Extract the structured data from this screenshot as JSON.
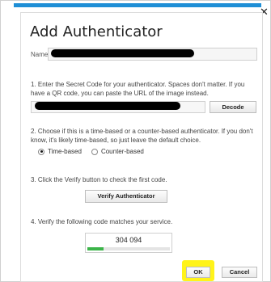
{
  "window": {
    "minimize_glyph": "–",
    "close_glyph": "✕",
    "accent_color": "#1f8fd6"
  },
  "dialog": {
    "title": "Add Authenticator",
    "name_label": "Name"
  },
  "steps": {
    "step1": "1. Enter the Secret Code for your authenticator. Spaces don't matter. If you have a QR code, you can paste the URL of the image instead.",
    "step2": "2. Choose if this is a time-based or a counter-based authenticator. If you don't know, it's likely time-based, so just leave the default choice.",
    "step3": "3. Click the Verify button to check the first code.",
    "step4": "4. Verify the following code matches your service."
  },
  "buttons": {
    "decode": "Decode",
    "verify": "Verify Authenticator",
    "ok": "OK",
    "cancel": "Cancel"
  },
  "radio_options": [
    {
      "label": "Time-based",
      "selected": true
    },
    {
      "label": "Counter-based",
      "selected": false
    }
  ],
  "code": {
    "value": "304 094",
    "progress_fraction": 0.2,
    "progress_color": "#3bb449"
  },
  "highlight_color": "#fff31a"
}
